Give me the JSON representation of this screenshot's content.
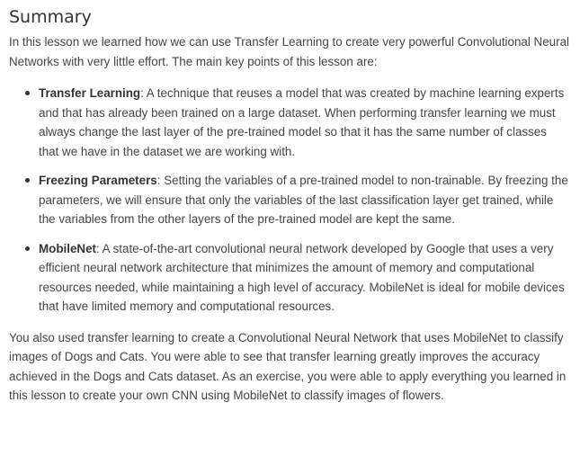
{
  "summary": {
    "title": "Summary",
    "intro": "In this lesson we learned how we can use Transfer Learning to create very powerful Convolutional Neural Networks with very little effort. The main key points of this lesson are:",
    "points": [
      {
        "term": "Transfer Learning",
        "text": ": A technique that reuses a model that was created by machine learning experts and that has already been trained on a large dataset. When performing transfer learning we must always change the last layer of the pre-trained model so that it has the same number of classes that we have in the dataset we are working with."
      },
      {
        "term": "Freezing Parameters",
        "text": ": Setting the variables of a pre-trained model to non-trainable. By freezing the parameters, we will ensure that only the variables of the last classification layer get trained, while the variables from the other layers of the pre-trained model are kept the same."
      },
      {
        "term": "MobileNet",
        "text": ": A state-of-the-art convolutional neural network developed by Google that uses a very efficient neural network architecture that minimizes the amount of memory and computational resources needed, while maintaining a high level of accuracy. MobileNet is ideal for mobile devices that have limited memory and computational resources."
      }
    ],
    "closing": "You also used transfer learning to create a Convolutional Neural Network that uses MobileNet to classify images of Dogs and Cats. You were able to see that transfer learning greatly improves the accuracy achieved in the Dogs and Cats dataset. As an exercise, you were able to apply everything you learned in this lesson to create your own CNN using MobileNet to classify images of flowers."
  }
}
